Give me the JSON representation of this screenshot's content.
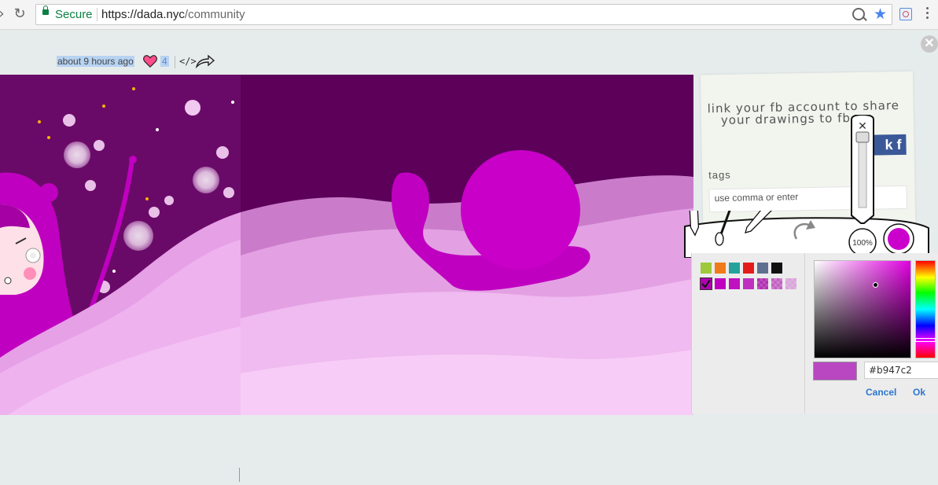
{
  "browser": {
    "secure_label": "Secure",
    "url_host": "https://dada.nyc",
    "url_path": "/community"
  },
  "post": {
    "time": "about 9 hours ago",
    "likes": "4",
    "embed_icon": "</>"
  },
  "fb_panel": {
    "line1": "link your fb account to share",
    "line2": "your drawings to fb.",
    "button_label": "k f",
    "tags_label": "tags",
    "tags_placeholder": "use comma or enter"
  },
  "toolbar": {
    "zoom": "100%",
    "current_color": "#cc00cc"
  },
  "color_picker": {
    "swatches_row1": [
      "#9dc93a",
      "#f07b1a",
      "#25a39a",
      "#e41b1b",
      "#5e6f8f",
      "#111111"
    ],
    "swatches_row2": [
      "#b000b0",
      "#c000c0",
      "#c010c0",
      "#c030c0",
      "#c050c0",
      "#d080d0",
      "#e0a0e0"
    ],
    "hex_value": "#b947c2",
    "preview_color": "#b947c2",
    "cancel_label": "Cancel",
    "ok_label": "Ok"
  }
}
